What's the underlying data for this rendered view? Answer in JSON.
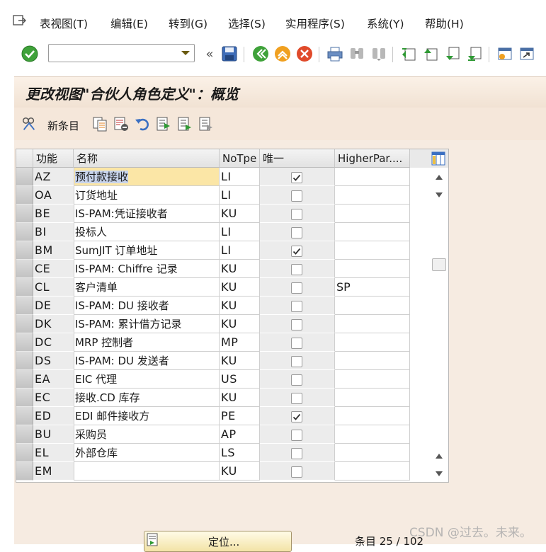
{
  "menu": {
    "items": [
      "表视图(T)",
      "编辑(E)",
      "转到(G)",
      "选择(S)",
      "实用程序(S)",
      "系统(Y)",
      "帮助(H)"
    ]
  },
  "toolbar": {
    "command_value": ""
  },
  "screen": {
    "title": "更改视图\"合伙人角色定义\"：概览",
    "new_entries_label": "新条目"
  },
  "table": {
    "columns": [
      "功能",
      "名称",
      "NoTpe",
      "唯一",
      "HigherPar...."
    ],
    "rows": [
      {
        "func": "AZ",
        "name": "预付款接收",
        "notpe": "LI",
        "unique": true,
        "higher": ""
      },
      {
        "func": "OA",
        "name": "订货地址",
        "notpe": "LI",
        "unique": false,
        "higher": ""
      },
      {
        "func": "BE",
        "name": "IS-PAM:凭证接收者",
        "notpe": "KU",
        "unique": false,
        "higher": ""
      },
      {
        "func": "BI",
        "name": "投标人",
        "notpe": "LI",
        "unique": false,
        "higher": ""
      },
      {
        "func": "BM",
        "name": "SumJIT 订单地址",
        "notpe": "LI",
        "unique": true,
        "higher": ""
      },
      {
        "func": "CE",
        "name": "IS-PAM: Chiffre 记录",
        "notpe": "KU",
        "unique": false,
        "higher": ""
      },
      {
        "func": "CL",
        "name": "客户清单",
        "notpe": "KU",
        "unique": false,
        "higher": "SP"
      },
      {
        "func": "DE",
        "name": "IS-PAM: DU 接收者",
        "notpe": "KU",
        "unique": false,
        "higher": ""
      },
      {
        "func": "DK",
        "name": "IS-PAM: 累计借方记录",
        "notpe": "KU",
        "unique": false,
        "higher": ""
      },
      {
        "func": "DC",
        "name": "MRP 控制者",
        "notpe": "MP",
        "unique": false,
        "higher": ""
      },
      {
        "func": "DS",
        "name": "IS-PAM: DU 发送者",
        "notpe": "KU",
        "unique": false,
        "higher": ""
      },
      {
        "func": "EA",
        "name": "EIC 代理",
        "notpe": "US",
        "unique": false,
        "higher": ""
      },
      {
        "func": "EC",
        "name": "接收.CD 库存",
        "notpe": "KU",
        "unique": false,
        "higher": ""
      },
      {
        "func": "ED",
        "name": "EDI 邮件接收方",
        "notpe": "PE",
        "unique": true,
        "higher": ""
      },
      {
        "func": "BU",
        "name": "采购员",
        "notpe": "AP",
        "unique": false,
        "higher": ""
      },
      {
        "func": "EL",
        "name": "外部仓库",
        "notpe": "LS",
        "unique": false,
        "higher": ""
      },
      {
        "func": "EM",
        "name": "",
        "notpe": "KU",
        "unique": false,
        "higher": ""
      }
    ]
  },
  "footer": {
    "position_button": "定位...",
    "entries": "条目 25 / 102",
    "watermark": "CSDN @过去。未来。"
  }
}
